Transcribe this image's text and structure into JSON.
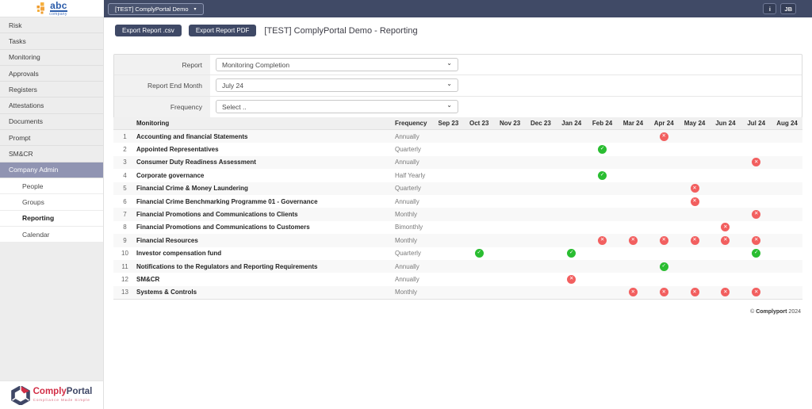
{
  "brand": {
    "company_logo_text": "abc",
    "company_logo_sub": "company",
    "portal_comply": "Comply",
    "portal_portal": "Portal",
    "portal_tagline": "Compliance Made Simple"
  },
  "header": {
    "company_selector": "[TEST] ComplyPortal Demo",
    "info_button": "i",
    "user_initials": "JB"
  },
  "sidebar": {
    "items": [
      {
        "label": "Risk"
      },
      {
        "label": "Tasks"
      },
      {
        "label": "Monitoring"
      },
      {
        "label": "Approvals"
      },
      {
        "label": "Registers"
      },
      {
        "label": "Attestations"
      },
      {
        "label": "Documents"
      },
      {
        "label": "Prompt"
      },
      {
        "label": "SM&CR"
      },
      {
        "label": "Company Admin",
        "selected": true
      },
      {
        "label": "People",
        "sub": true
      },
      {
        "label": "Groups",
        "sub": true
      },
      {
        "label": "Reporting",
        "sub": true,
        "active": true
      },
      {
        "label": "Calendar",
        "sub": true
      }
    ]
  },
  "toolbar": {
    "export_csv_label": "Export Report .csv",
    "export_pdf_label": "Export Report PDF",
    "page_title": "[TEST] ComplyPortal Demo - Reporting"
  },
  "filters": [
    {
      "label": "Report",
      "value": "Monitoring Completion"
    },
    {
      "label": "Report End Month",
      "value": "July 24"
    },
    {
      "label": "Frequency",
      "value": "Select .."
    }
  ],
  "table": {
    "monitoring_header": "Monitoring",
    "frequency_header": "Frequency",
    "months": [
      "Sep 23",
      "Oct 23",
      "Nov 23",
      "Dec 23",
      "Jan 24",
      "Feb 24",
      "Mar 24",
      "Apr 24",
      "May 24",
      "Jun 24",
      "Jul 24",
      "Aug 24"
    ],
    "rows": [
      {
        "num": "1",
        "name": "Accounting and financial Statements",
        "frequency": "Annually",
        "statuses": [
          "",
          "",
          "",
          "",
          "",
          "",
          "",
          "fail",
          "",
          "",
          "",
          ""
        ]
      },
      {
        "num": "2",
        "name": "Appointed Representatives",
        "frequency": "Quarterly",
        "statuses": [
          "",
          "",
          "",
          "",
          "",
          "pass",
          "",
          "",
          "",
          "",
          "",
          ""
        ]
      },
      {
        "num": "3",
        "name": "Consumer Duty Readiness Assessment",
        "frequency": "Annually",
        "statuses": [
          "",
          "",
          "",
          "",
          "",
          "",
          "",
          "",
          "",
          "",
          "fail",
          ""
        ]
      },
      {
        "num": "4",
        "name": "Corporate governance",
        "frequency": "Half Yearly",
        "statuses": [
          "",
          "",
          "",
          "",
          "",
          "pass",
          "",
          "",
          "",
          "",
          "",
          ""
        ]
      },
      {
        "num": "5",
        "name": "Financial Crime & Money Laundering",
        "frequency": "Quarterly",
        "statuses": [
          "",
          "",
          "",
          "",
          "",
          "",
          "",
          "",
          "fail",
          "",
          "",
          ""
        ]
      },
      {
        "num": "6",
        "name": "Financial Crime Benchmarking Programme 01 - Governance",
        "frequency": "Annually",
        "statuses": [
          "",
          "",
          "",
          "",
          "",
          "",
          "",
          "",
          "fail",
          "",
          "",
          ""
        ]
      },
      {
        "num": "7",
        "name": "Financial Promotions and Communications to Clients",
        "frequency": "Monthly",
        "statuses": [
          "",
          "",
          "",
          "",
          "",
          "",
          "",
          "",
          "",
          "",
          "fail",
          ""
        ]
      },
      {
        "num": "8",
        "name": "Financial Promotions and Communications to Customers",
        "frequency": "Bimonthly",
        "statuses": [
          "",
          "",
          "",
          "",
          "",
          "",
          "",
          "",
          "",
          "fail",
          "",
          ""
        ]
      },
      {
        "num": "9",
        "name": "Financial Resources",
        "frequency": "Monthly",
        "statuses": [
          "",
          "",
          "",
          "",
          "",
          "fail",
          "fail",
          "fail",
          "fail",
          "fail",
          "fail",
          ""
        ]
      },
      {
        "num": "10",
        "name": "Investor compensation fund",
        "frequency": "Quarterly",
        "statuses": [
          "",
          "pass",
          "",
          "",
          "pass",
          "",
          "",
          "",
          "",
          "",
          "pass",
          ""
        ]
      },
      {
        "num": "11",
        "name": "Notifications to the Regulators and Reporting Requirements",
        "frequency": "Annually",
        "statuses": [
          "",
          "",
          "",
          "",
          "",
          "",
          "",
          "pass",
          "",
          "",
          "",
          ""
        ]
      },
      {
        "num": "12",
        "name": "SM&CR",
        "frequency": "Annually",
        "statuses": [
          "",
          "",
          "",
          "",
          "fail",
          "",
          "",
          "",
          "",
          "",
          "",
          ""
        ]
      },
      {
        "num": "13",
        "name": "Systems & Controls",
        "frequency": "Monthly",
        "statuses": [
          "",
          "",
          "",
          "",
          "",
          "",
          "fail",
          "fail",
          "fail",
          "fail",
          "fail",
          ""
        ]
      }
    ]
  },
  "footer": {
    "copyright_symbol": "©",
    "copyright_name": "Complyport",
    "copyright_year": "2024"
  },
  "icons": {
    "company_selector_caret": "▾",
    "select_caret": "⌄",
    "status_pass_glyph": "✓",
    "status_fail_glyph": "✕"
  },
  "colors": {
    "header_navy": "#404a66",
    "button_navy": "#3f4966",
    "sidebar_selected": "#9094b2",
    "status_pass_green": "#2abd31",
    "status_fail_red": "#f25f5f",
    "brand_red": "#d22e46",
    "brand_navy": "#3f4766",
    "abc_blue": "#2b5caa",
    "abc_orange": "#f2a33c"
  }
}
